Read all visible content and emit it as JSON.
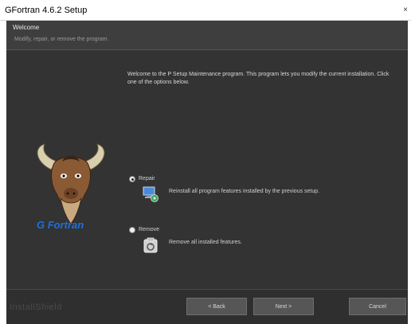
{
  "window": {
    "title": "GFortran 4.6.2 Setup",
    "close_glyph": "×"
  },
  "header": {
    "title": "Welcome",
    "subtitle": "Modify, repair, or remove the program."
  },
  "main": {
    "intro": "Welcome to the P Setup Maintenance program. This program lets you modify the current installation. Click one of the options below.",
    "logo_text": "G Fortran",
    "options": [
      {
        "label": "Repair",
        "description": "Reinstall all program features installed by the previous setup.",
        "selected": true,
        "icon": "repair-icon"
      },
      {
        "label": "Remove",
        "description": "Remove all installed features.",
        "selected": false,
        "icon": "remove-icon"
      }
    ]
  },
  "footer": {
    "brand": "InstallShield",
    "back_label": "< Back",
    "next_label": "Next >",
    "cancel_label": "Cancel"
  },
  "colors": {
    "background": "#303030",
    "header": "#3e3e3e",
    "logo_text": "#1e6fe0"
  }
}
